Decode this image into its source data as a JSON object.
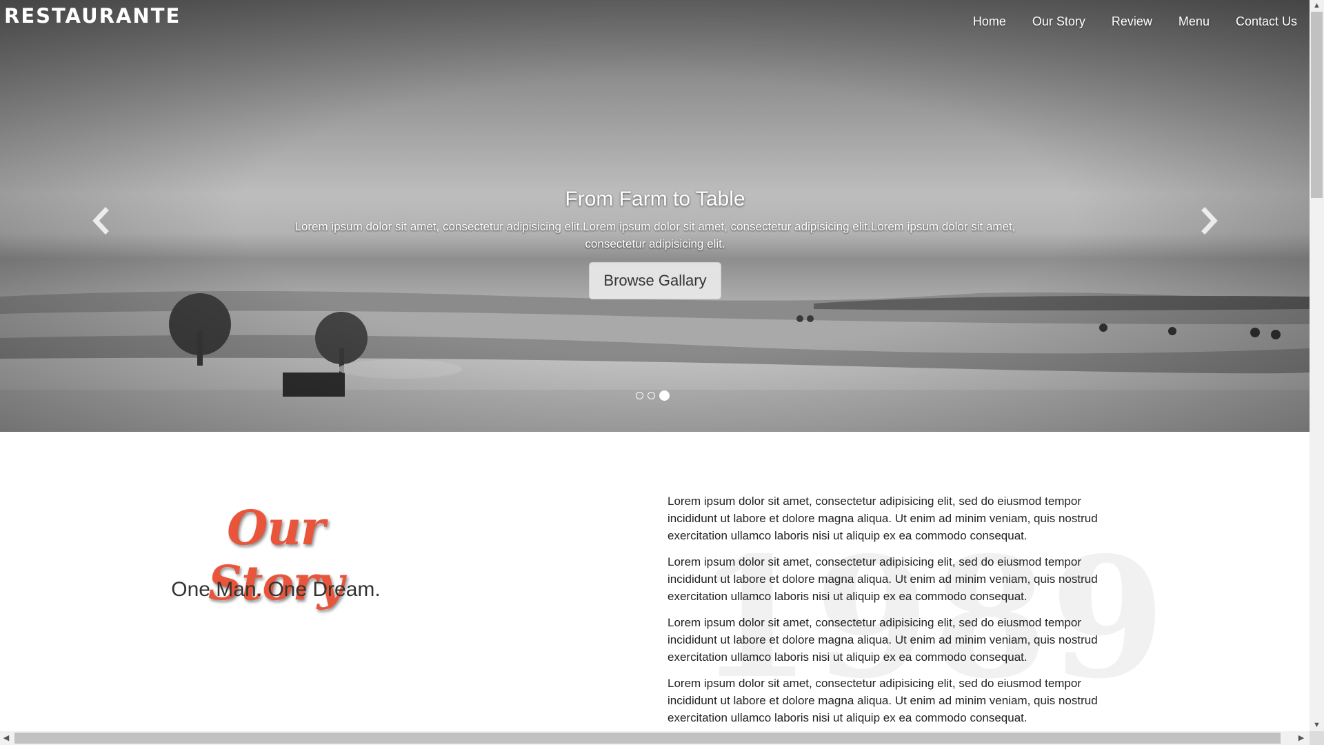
{
  "brand": {
    "logo": "RESTAURANTE"
  },
  "nav": {
    "items": [
      {
        "label": "Home"
      },
      {
        "label": "Our Story"
      },
      {
        "label": "Review"
      },
      {
        "label": "Menu"
      },
      {
        "label": "Contact Us"
      }
    ]
  },
  "hero": {
    "title": "From Farm to Table",
    "text": "Lorem ipsum dolor sit amet, consectetur adipisicing elit.Lorem ipsum dolor sit amet, consectetur adipisicing elit.Lorem ipsum dolor sit amet, consectetur adipisicing elit.",
    "button_label": "Browse Gallary",
    "prev_icon": "chevron-left-icon",
    "next_icon": "chevron-right-icon",
    "slides": 3,
    "active_slide": 3
  },
  "story": {
    "heading": "Our Story",
    "subheading": "One Man. One Dream.",
    "watermark": "1989",
    "paragraphs": [
      "Lorem ipsum dolor sit amet, consectetur adipisicing elit, sed do eiusmod tempor incididunt ut labore et dolore magna aliqua. Ut enim ad minim veniam, quis nostrud exercitation ullamco laboris nisi ut aliquip ex ea commodo consequat.",
      "Lorem ipsum dolor sit amet, consectetur adipisicing elit, sed do eiusmod tempor incididunt ut labore et dolore magna aliqua. Ut enim ad minim veniam, quis nostrud exercitation ullamco laboris nisi ut aliquip ex ea commodo consequat.",
      "Lorem ipsum dolor sit amet, consectetur adipisicing elit, sed do eiusmod tempor incididunt ut labore et dolore magna aliqua. Ut enim ad minim veniam, quis nostrud exercitation ullamco laboris nisi ut aliquip ex ea commodo consequat.",
      "Lorem ipsum dolor sit amet, consectetur adipisicing elit, sed do eiusmod tempor incididunt ut labore et dolore magna aliqua. Ut enim ad minim veniam, quis nostrud exercitation ullamco laboris nisi ut aliquip ex ea commodo consequat."
    ]
  },
  "colors": {
    "accent": "#e8553a",
    "nav_text": "#ffffff",
    "body_text": "#222222"
  }
}
